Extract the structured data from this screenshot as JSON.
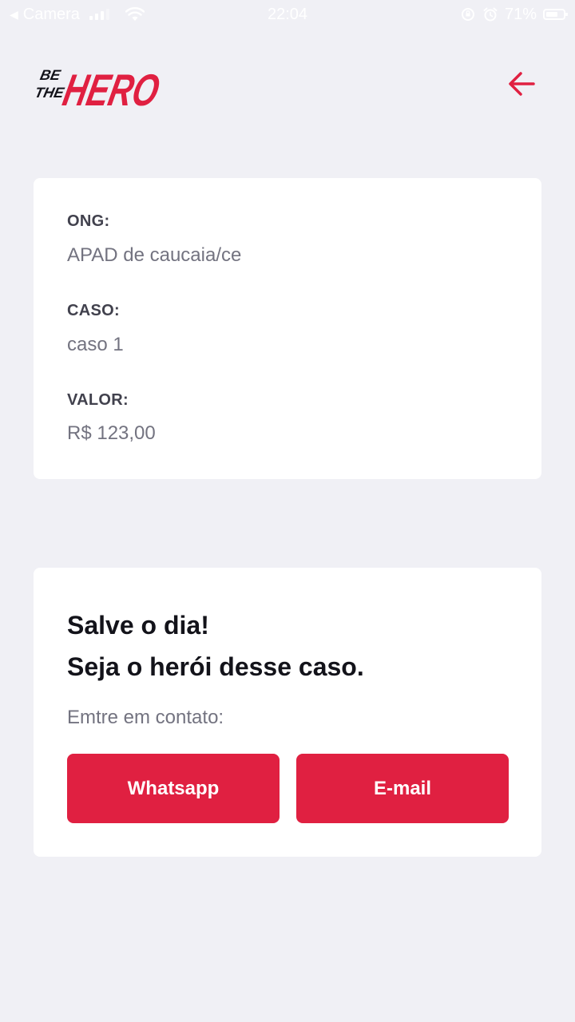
{
  "status_bar": {
    "back_label": "◀",
    "app_label": "Camera",
    "time": "22:04",
    "battery_text": "71%",
    "battery_level": 0.71
  },
  "header": {
    "logo_text_top": "BE",
    "logo_text_mid": "THE",
    "logo_text_main": "HERO",
    "back_icon": "arrow-left-icon"
  },
  "incident": {
    "ong_label": "ONG:",
    "ong_value": "APAD de caucaia/ce",
    "case_label": "CASO:",
    "case_value": "caso 1",
    "value_label": "VALOR:",
    "value_value": "R$ 123,00"
  },
  "contact": {
    "title_line1": "Salve o dia!",
    "title_line2": "Seja o herói desse caso.",
    "prompt": "Emtre em contato:",
    "whatsapp_label": "Whatsapp",
    "email_label": "E-mail"
  },
  "colors": {
    "brand_red": "#e02041",
    "background": "#f0f0f5",
    "card": "#ffffff",
    "label_text": "#41414d",
    "value_text": "#737380",
    "title_text": "#13131a"
  }
}
